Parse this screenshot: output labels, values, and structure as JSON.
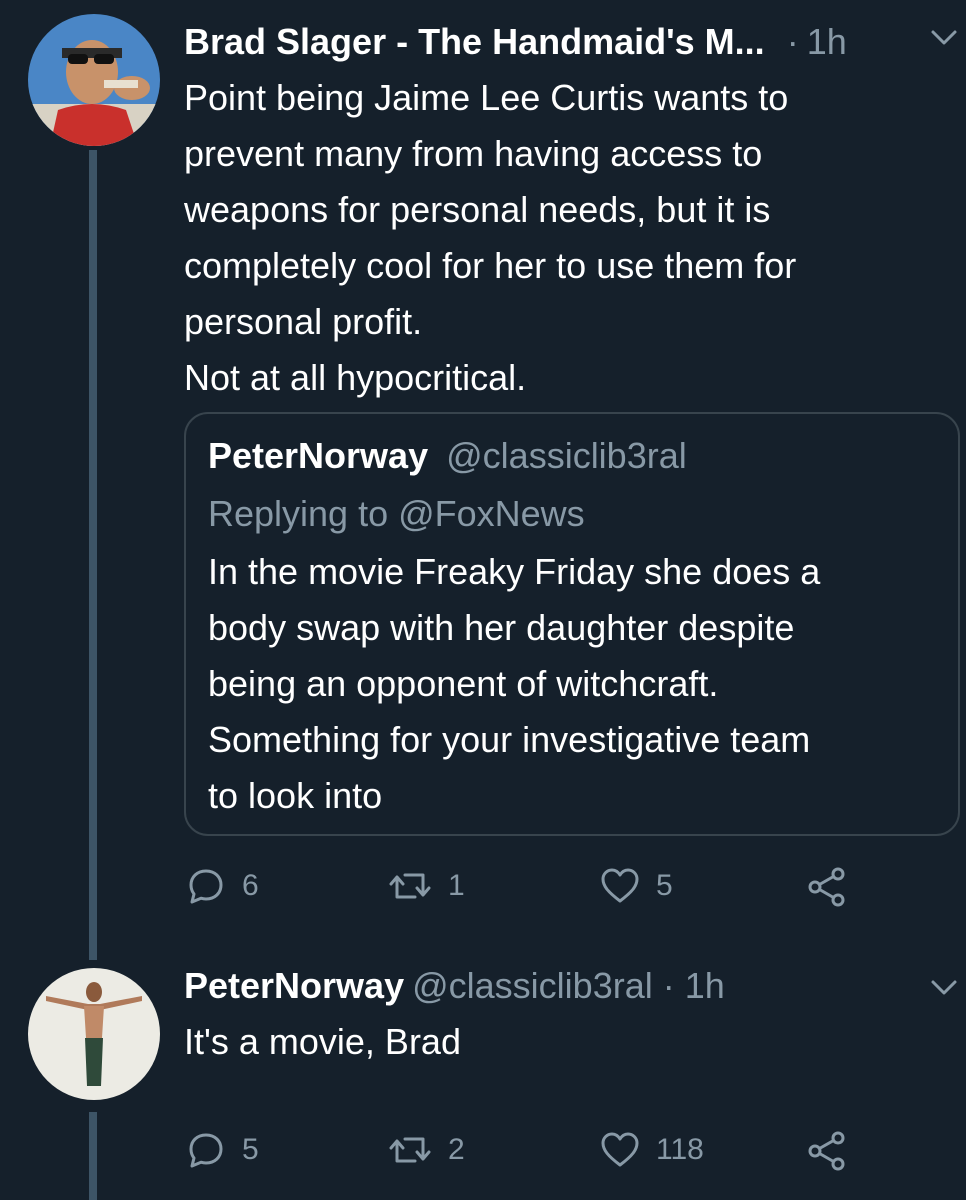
{
  "tweet1": {
    "author_name": "Brad Slager - The Handmaid's M...",
    "separator": "·",
    "time": "1h",
    "lines": [
      "Point being Jaime Lee Curtis wants to",
      "prevent many from having access to",
      "weapons for personal needs, but it is",
      "completely cool for her to use them for",
      "personal profit.",
      "Not at all hypocritical."
    ],
    "quoted": {
      "author_name": "PeterNorway",
      "handle": "@classiclib3ral",
      "replying_to": "Replying to @FoxNews",
      "lines": [
        "In the movie Freaky Friday she does a",
        "body swap with her daughter despite",
        "being an opponent of witchcraft.",
        "Something for your investigative team",
        "to look into"
      ]
    },
    "actions": {
      "replies": "6",
      "retweets": "1",
      "likes": "5"
    }
  },
  "tweet2": {
    "author_name": "PeterNorway",
    "handle": "@classiclib3ral",
    "separator": "·",
    "time": "1h",
    "lines": [
      "It's a movie, Brad"
    ],
    "actions": {
      "replies": "5",
      "retweets": "2",
      "likes": "118"
    }
  },
  "icons": {
    "reply": "reply-bubble-icon",
    "retweet": "retweet-icon",
    "like": "heart-icon",
    "share": "share-icon",
    "menu": "chevron-down-icon"
  },
  "colors": {
    "background": "#15202b",
    "text": "#ffffff",
    "secondary": "#8899a6",
    "border": "#38444d",
    "thread_line": "#3d5466"
  }
}
